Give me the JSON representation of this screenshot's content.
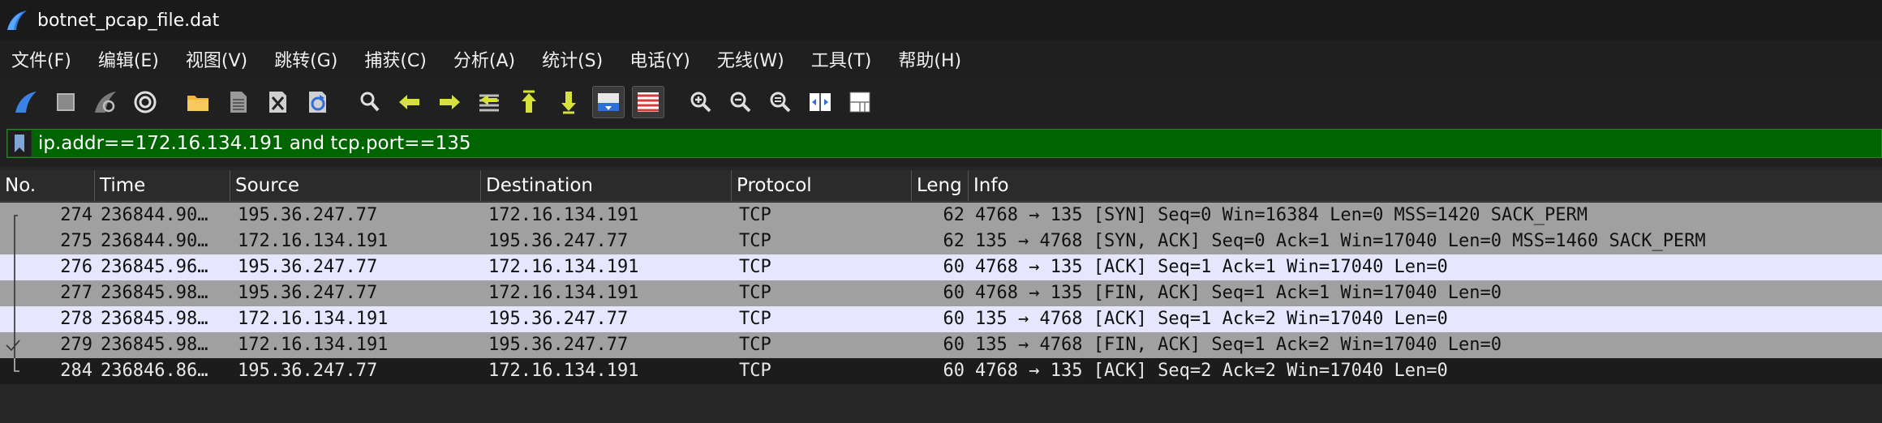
{
  "window": {
    "title": "botnet_pcap_file.dat"
  },
  "menu": [
    "文件(F)",
    "编辑(E)",
    "视图(V)",
    "跳转(G)",
    "捕获(C)",
    "分析(A)",
    "统计(S)",
    "电话(Y)",
    "无线(W)",
    "工具(T)",
    "帮助(H)"
  ],
  "toolbar": {
    "buttons": [
      "shark-fin-start-icon",
      "stop-square-icon",
      "restart-fin-icon",
      "capture-options-gear-icon",
      "open-folder-icon",
      "file-document-icon",
      "close-file-icon",
      "reload-icon",
      "find-magnifier-icon",
      "go-back-arrow-icon",
      "go-forward-arrow-icon",
      "go-to-packet-icon",
      "first-packet-icon",
      "last-packet-icon",
      "autoscroll-icon",
      "colorize-icon",
      "zoom-in-icon",
      "zoom-out-icon",
      "zoom-normal-icon",
      "resize-columns-icon",
      "layout-icon"
    ]
  },
  "filter": {
    "value": "ip.addr==172.16.134.191 and tcp.port==135"
  },
  "columns": [
    "No.",
    "Time",
    "Source",
    "Destination",
    "Protocol",
    "Leng",
    "Info"
  ],
  "packets": [
    {
      "no": "274",
      "time": "236844.90…",
      "src": "195.36.247.77",
      "dst": "172.16.134.191",
      "proto": "TCP",
      "len": "62",
      "info": "4768 → 135 [SYN] Seq=0 Win=16384 Len=0 MSS=1420 SACK_PERM",
      "style": "gray",
      "conv": "start"
    },
    {
      "no": "275",
      "time": "236844.90…",
      "src": "172.16.134.191",
      "dst": "195.36.247.77",
      "proto": "TCP",
      "len": "62",
      "info": "135 → 4768 [SYN, ACK] Seq=0 Ack=1 Win=17040 Len=0 MSS=1460 SACK_PERM",
      "style": "gray",
      "conv": "mid"
    },
    {
      "no": "276",
      "time": "236845.96…",
      "src": "195.36.247.77",
      "dst": "172.16.134.191",
      "proto": "TCP",
      "len": "60",
      "info": "4768 → 135 [ACK] Seq=1 Ack=1 Win=17040 Len=0",
      "style": "lav",
      "conv": "mid"
    },
    {
      "no": "277",
      "time": "236845.98…",
      "src": "195.36.247.77",
      "dst": "172.16.134.191",
      "proto": "TCP",
      "len": "60",
      "info": "4768 → 135 [FIN, ACK] Seq=1 Ack=1 Win=17040 Len=0",
      "style": "gray",
      "conv": "mid"
    },
    {
      "no": "278",
      "time": "236845.98…",
      "src": "172.16.134.191",
      "dst": "195.36.247.77",
      "proto": "TCP",
      "len": "60",
      "info": "135 → 4768 [ACK] Seq=1 Ack=2 Win=17040 Len=0",
      "style": "lav",
      "conv": "mid"
    },
    {
      "no": "279",
      "time": "236845.98…",
      "src": "172.16.134.191",
      "dst": "195.36.247.77",
      "proto": "TCP",
      "len": "60",
      "info": "135 → 4768 [FIN, ACK] Seq=1 Ack=2 Win=17040 Len=0",
      "style": "gray",
      "conv": "check"
    },
    {
      "no": "284",
      "time": "236846.86…",
      "src": "195.36.247.77",
      "dst": "172.16.134.191",
      "proto": "TCP",
      "len": "60",
      "info": "4768 → 135 [ACK] Seq=2 Ack=2 Win=17040 Len=0",
      "style": "sel",
      "conv": "end"
    }
  ],
  "colors": {
    "filter_valid_bg": "#006400",
    "row_gray": "#a0a0a0",
    "row_lavender": "#e7e6ff",
    "row_selected": "#1c1c1c"
  }
}
